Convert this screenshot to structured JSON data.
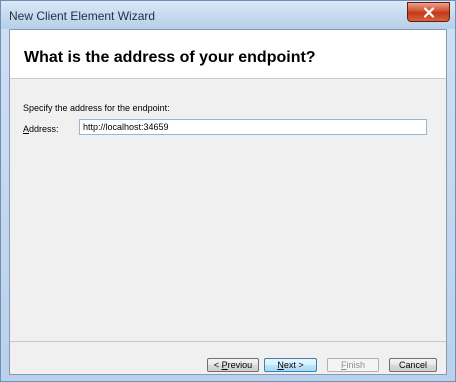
{
  "window": {
    "title": "New Client Element Wizard",
    "close_glyph": "X"
  },
  "header": {
    "heading": "What is the address of your endpoint?"
  },
  "form": {
    "instruction": "Specify the address for the endpoint:",
    "address_label_accel": "A",
    "address_label_rest": "ddress:",
    "address_value": "http://localhost:34659"
  },
  "buttons": {
    "previous_prefix": "< ",
    "previous_accel": "P",
    "previous_rest": "reviou",
    "next_accel": "N",
    "next_rest": "ext >",
    "finish_accel": "F",
    "finish_rest": "inish",
    "cancel_label": "Cancel"
  },
  "icons": {
    "close": "close-icon"
  },
  "colors": {
    "titlebar": "#c5d9ef",
    "close_button": "#c0391a",
    "client_bg": "#f0f0f0",
    "default_button_border": "#3c7fb1"
  }
}
